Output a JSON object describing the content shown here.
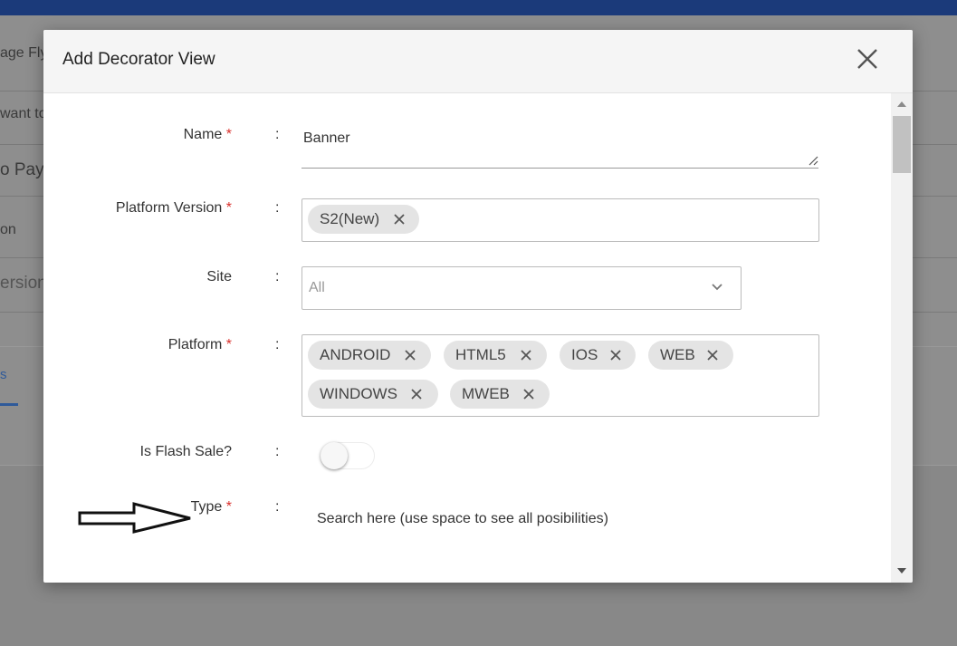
{
  "background": {
    "texts": [
      "age Fly",
      "want to",
      "o Pay",
      "on",
      "ersion"
    ],
    "tab_label": "s"
  },
  "modal": {
    "title": "Add Decorator View",
    "close_icon": "close-icon"
  },
  "form": {
    "colon": ":",
    "required_marker": "*",
    "name": {
      "label": "Name",
      "value": "Banner"
    },
    "platform_version": {
      "label": "Platform Version",
      "chips": [
        "S2(New)"
      ]
    },
    "site": {
      "label": "Site",
      "value": "All"
    },
    "platform": {
      "label": "Platform",
      "chips": [
        "ANDROID",
        "HTML5",
        "IOS",
        "WEB",
        "WINDOWS",
        "MWEB"
      ]
    },
    "flash_sale": {
      "label": "Is Flash Sale?",
      "on": false
    },
    "type": {
      "label": "Type",
      "placeholder": "Search here (use space to see all posibilities)"
    }
  },
  "colors": {
    "topbar": "#1b3a7a",
    "required": "#d9302c",
    "chip_bg": "#e4e4e4"
  }
}
